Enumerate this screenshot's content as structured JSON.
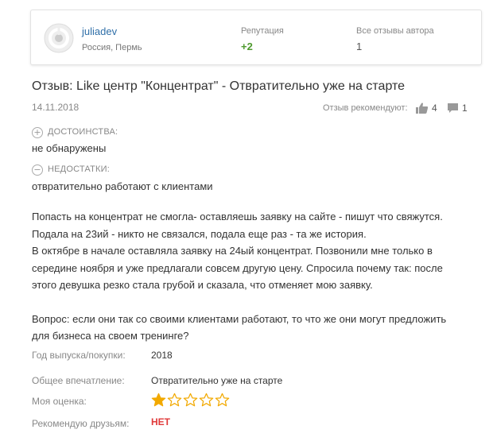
{
  "author": {
    "name": "juliadev",
    "location": "Россия, Пермь",
    "reputation_label": "Репутация",
    "reputation_value": "+2",
    "all_reviews_label": "Все отзывы автора",
    "all_reviews_value": "1"
  },
  "review": {
    "title": "Отзыв: Like центр \"Концентрат\" - Отвратительно уже на старте",
    "date": "14.11.2018",
    "recommend_label": "Отзыв рекомендуют:",
    "likes": "4",
    "comments": "1",
    "pros_label": "ДОСТОИНСТВА:",
    "pros_text": "не обнаружены",
    "cons_label": "НЕДОСТАТКИ:",
    "cons_text": "отвратительно работают с клиентами",
    "body": [
      "Попасть на концентрат не смогла- оставляешь заявку на сайте - пишут что свяжутся.",
      "Подала на 23ий - никто не связался, подала еще раз - та же история.",
      "В октябре в начале оставляла заявку на 24ый концентрат. Позвонили мне только в",
      "середине ноября и уже предлагали совсем другую цену. Спросила почему так: после",
      "этого девушка резко стала грубой и сказала, что отменяет мою заявку.",
      "Вопрос: если они так со своими клиентами работают, то что же они могут предложить",
      "для бизнеса на своем тренинге?"
    ]
  },
  "meta": {
    "year_label": "Год выпуска/покупки:",
    "year_value": "2018",
    "impression_label": "Общее впечатление:",
    "impression_value": "Отвратительно уже на старте",
    "rating_label": "Моя оценка:",
    "rating_value": 1,
    "rating_max": 5,
    "recommend_friends_label": "Рекомендую друзьям:",
    "recommend_friends_value": "НЕТ"
  },
  "colors": {
    "link": "#2f6fa8",
    "reputation": "#4f9a2f",
    "star": "#f2a900",
    "no": "#e03a3a"
  }
}
